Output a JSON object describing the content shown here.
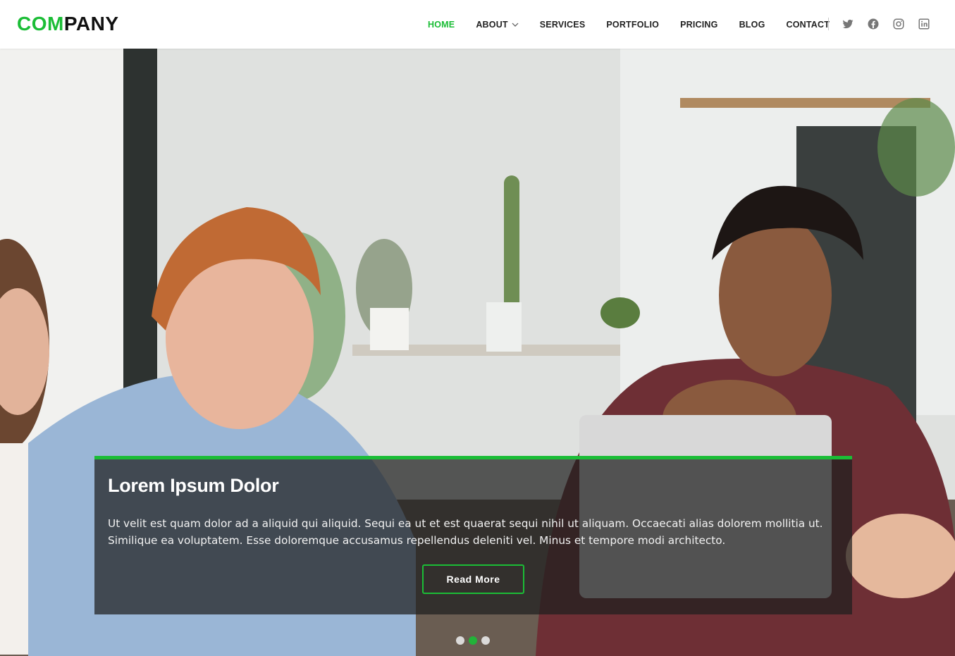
{
  "header": {
    "logo_part1": "COM",
    "logo_part2": "PANY",
    "nav": [
      {
        "label": "HOME",
        "active": true
      },
      {
        "label": "ABOUT",
        "dropdown": true
      },
      {
        "label": "SERVICES"
      },
      {
        "label": "PORTFOLIO"
      },
      {
        "label": "PRICING"
      },
      {
        "label": "BLOG"
      },
      {
        "label": "CONTACT"
      }
    ],
    "socials": [
      "twitter-icon",
      "facebook-icon",
      "instagram-icon",
      "linkedin-icon"
    ]
  },
  "hero": {
    "title": "Lorem Ipsum Dolor",
    "text": "Ut velit est quam dolor ad a aliquid qui aliquid. Sequi ea ut et est quaerat sequi nihil ut aliquam. Occaecati alias dolorem mollitia ut. Similique ea voluptatem. Esse doloremque accusamus repellendus deleniti vel. Minus et tempore modi architecto.",
    "button_label": "Read More",
    "slides_count": 3,
    "active_slide": 2
  },
  "colors": {
    "accent": "#1bbd36",
    "text_dark": "#222222",
    "caption_bg": "rgba(30,30,30,0.72)"
  }
}
